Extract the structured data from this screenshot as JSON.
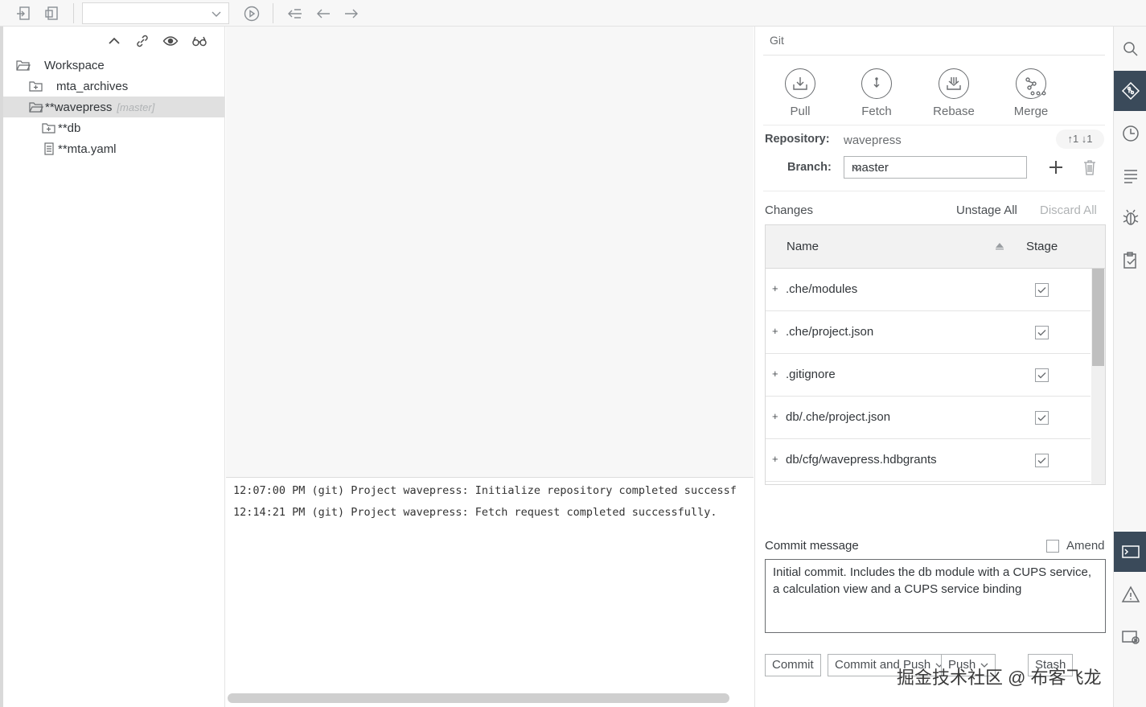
{
  "toolbar": {
    "select_value": "",
    "icons": [
      "import-project-icon",
      "export-project-icon",
      "run-icon",
      "back-history-icon",
      "back-arrow-icon",
      "forward-arrow-icon"
    ]
  },
  "explorer": {
    "tools": [
      "collapse-all-icon",
      "link-with-editor-icon",
      "show-hidden-icon",
      "binoculars-icon"
    ],
    "tree": [
      {
        "label": "Workspace",
        "branch": "",
        "icon": "folder-open-icon"
      },
      {
        "label": "mta_archives",
        "branch": "",
        "icon": "folder-icon"
      },
      {
        "label": "**wavepress",
        "branch": "[master]",
        "icon": "folder-open-icon"
      },
      {
        "label": "**db",
        "branch": "",
        "icon": "folder-icon"
      },
      {
        "label": "**mta.yaml",
        "branch": "",
        "icon": "file-icon"
      }
    ]
  },
  "console": {
    "lines": [
      "12:07:00 PM (git) Project wavepress: Initialize repository completed successf",
      "12:14:21 PM (git) Project wavepress: Fetch request completed successfully."
    ]
  },
  "git": {
    "title": "Git",
    "actions": {
      "pull": "Pull",
      "fetch": "Fetch",
      "rebase": "Rebase",
      "merge": "Merge"
    },
    "repository_label": "Repository:",
    "repository_value": "wavepress",
    "sync_status": "↑1 ↓1",
    "branch_label": "Branch:",
    "branch_value": "master",
    "changes_label": "Changes",
    "unstage_all": "Unstage All",
    "discard_all": "Discard All",
    "columns": {
      "name": "Name",
      "stage": "Stage"
    },
    "changes": [
      {
        "prefix": "+",
        "name": ".che/modules",
        "staged": true
      },
      {
        "prefix": "+",
        "name": ".che/project.json",
        "staged": true
      },
      {
        "prefix": "+",
        "name": ".gitignore",
        "staged": true
      },
      {
        "prefix": "+",
        "name": "db/.che/project.json",
        "staged": true
      },
      {
        "prefix": "+",
        "name": "db/cfg/wavepress.hdbgrants",
        "staged": true
      }
    ],
    "commit_label": "Commit message",
    "amend_label": "Amend",
    "commit_message": "Initial commit. Includes the db module with a CUPS service, a calculation view and a CUPS service binding",
    "buttons": {
      "commit": "Commit",
      "commit_and_push": "Commit and Push",
      "push": "Push",
      "stash": "Stash"
    }
  },
  "sidebar": {
    "icons": [
      "search-icon",
      "git-icon",
      "history-icon",
      "outline-icon",
      "debug-icon",
      "clipboard-check-icon",
      "console-icon",
      "problems-icon",
      "run-console-icon"
    ]
  },
  "watermark": "掘金技术社区 @ 布客飞龙",
  "colors": {
    "active_sidebar": "#3a4a5a",
    "selected_row": "#e0e0e0",
    "toolbar_bg": "#f7f7f7"
  }
}
